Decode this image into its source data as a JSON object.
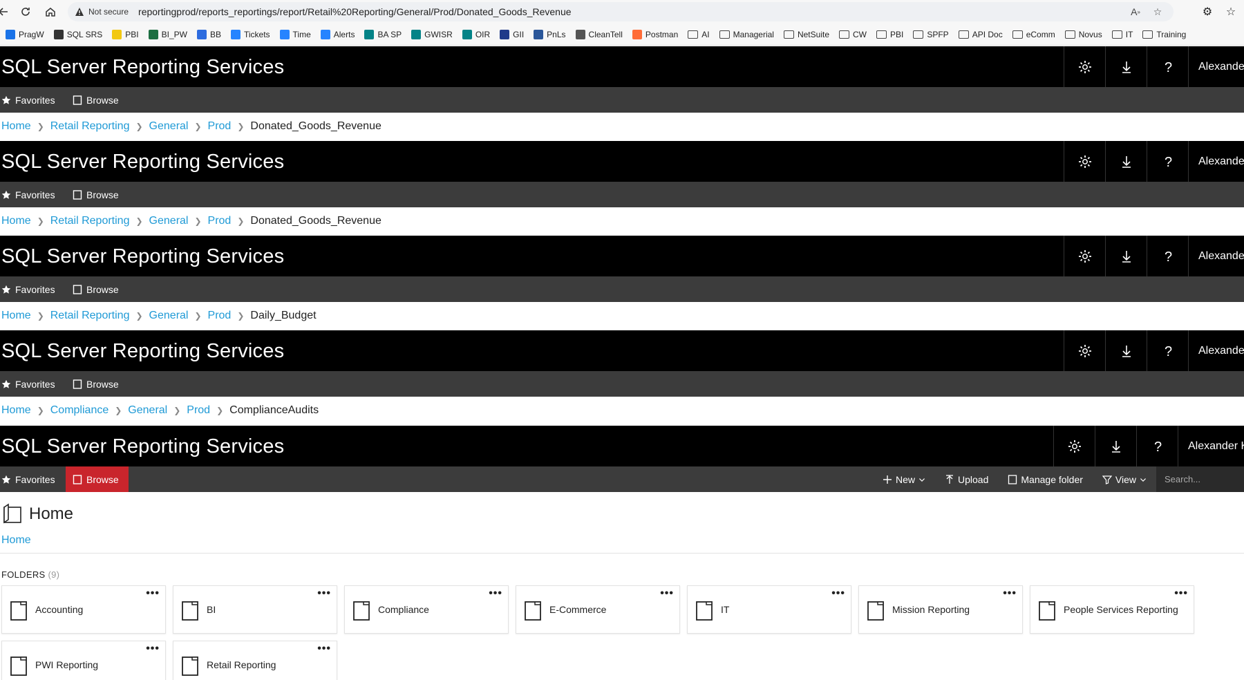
{
  "browser": {
    "security_label": "Not secure",
    "url": "reportingprod/reports_reportings/report/Retail%20Reporting/General/Prod/Donated_Goods_Revenue",
    "bookmarks": [
      {
        "label": "PragW",
        "icon": "globe-icon",
        "color": "#1a73e8"
      },
      {
        "label": "SQL SRS",
        "icon": "chart-icon",
        "color": "#333333"
      },
      {
        "label": "PBI",
        "icon": "powerbi-icon",
        "color": "#f2c811"
      },
      {
        "label": "BI_PW",
        "icon": "excel-icon",
        "color": "#1d6f42"
      },
      {
        "label": "BB",
        "icon": "shield-icon",
        "color": "#2d6cdf"
      },
      {
        "label": "Tickets",
        "icon": "jira-icon",
        "color": "#2684ff"
      },
      {
        "label": "Time",
        "icon": "jira-icon",
        "color": "#2684ff"
      },
      {
        "label": "Alerts",
        "icon": "jira-icon",
        "color": "#2684ff"
      },
      {
        "label": "BA SP",
        "icon": "sharepoint-icon",
        "color": "#038387"
      },
      {
        "label": "GWISR",
        "icon": "sharepoint-icon",
        "color": "#038387"
      },
      {
        "label": "OIR",
        "icon": "sharepoint-icon",
        "color": "#038387"
      },
      {
        "label": "GII",
        "icon": "doc-icon",
        "color": "#1f3a8a"
      },
      {
        "label": "PnLs",
        "icon": "word-icon",
        "color": "#2b579a"
      },
      {
        "label": "CleanTell",
        "icon": "cm-icon",
        "color": "#555555"
      },
      {
        "label": "Postman",
        "icon": "postman-icon",
        "color": "#ff6c37"
      },
      {
        "label": "AI",
        "icon": "folder-icon",
        "color": "#444444"
      },
      {
        "label": "Managerial",
        "icon": "folder-icon",
        "color": "#444444"
      },
      {
        "label": "NetSuite",
        "icon": "folder-icon",
        "color": "#444444"
      },
      {
        "label": "CW",
        "icon": "folder-icon",
        "color": "#444444"
      },
      {
        "label": "PBI",
        "icon": "folder-icon",
        "color": "#444444"
      },
      {
        "label": "SPFP",
        "icon": "folder-icon",
        "color": "#444444"
      },
      {
        "label": "API Doc",
        "icon": "folder-icon",
        "color": "#444444"
      },
      {
        "label": "eComm",
        "icon": "folder-icon",
        "color": "#444444"
      },
      {
        "label": "Novus",
        "icon": "folder-icon",
        "color": "#444444"
      },
      {
        "label": "IT",
        "icon": "folder-icon",
        "color": "#444444"
      },
      {
        "label": "Training",
        "icon": "folder-icon",
        "color": "#444444"
      }
    ]
  },
  "app_title": "SQL Server Reporting Services",
  "user_short": "Alexande",
  "user_full": "Alexander K",
  "nav": {
    "favorites": "Favorites",
    "browse": "Browse"
  },
  "breadcrumbs": [
    {
      "items": [
        "Home",
        "Retail Reporting",
        "General",
        "Prod"
      ],
      "current": "Donated_Goods_Revenue"
    },
    {
      "items": [
        "Home",
        "Retail Reporting",
        "General",
        "Prod"
      ],
      "current": "Donated_Goods_Revenue"
    },
    {
      "items": [
        "Home",
        "Retail Reporting",
        "General",
        "Prod"
      ],
      "current": "Daily_Budget"
    },
    {
      "items": [
        "Home",
        "Compliance",
        "General",
        "Prod"
      ],
      "current": "ComplianceAudits"
    }
  ],
  "toolbar": {
    "new": "New",
    "upload": "Upload",
    "manage_folder": "Manage folder",
    "view": "View",
    "search_placeholder": "Search..."
  },
  "home": {
    "title": "Home",
    "breadcrumb": "Home",
    "folders_label": "FOLDERS",
    "folders_count": "(9)",
    "folders": [
      "Accounting",
      "BI",
      "Compliance",
      "E-Commerce",
      "IT",
      "Mission Reporting",
      "People Services Reporting",
      "PWI Reporting",
      "Retail Reporting"
    ]
  },
  "colors": {
    "accent": "#c9252c",
    "link": "#1f9ad6",
    "header": "#000000",
    "nav": "#3c3c3c"
  }
}
